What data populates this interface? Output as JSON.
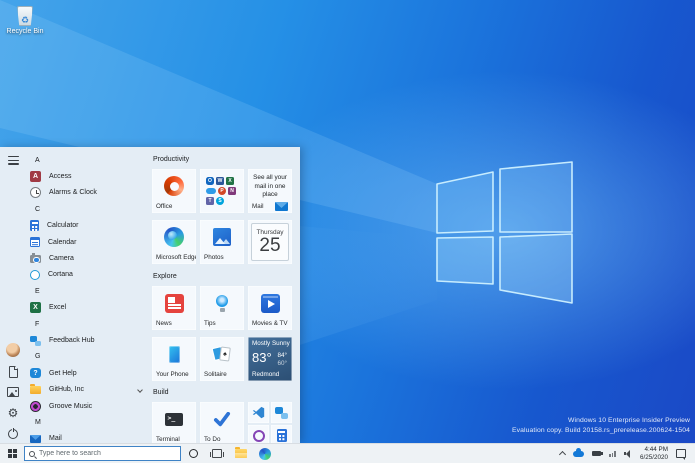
{
  "desktop": {
    "recycle_bin_label": "Recycle Bin",
    "watermark": {
      "line1": "Windows 10 Enterprise Insider Preview",
      "line2": "Evaluation copy. Build 20158.rs_prerelease.200624-1504"
    }
  },
  "start_menu": {
    "app_list": [
      {
        "type": "header",
        "label": "A"
      },
      {
        "type": "app",
        "label": "Access",
        "icon": "access-icon"
      },
      {
        "type": "app",
        "label": "Alarms & Clock",
        "icon": "alarms-clock-icon"
      },
      {
        "type": "header",
        "label": "C"
      },
      {
        "type": "app",
        "label": "Calculator",
        "icon": "calculator-icon"
      },
      {
        "type": "app",
        "label": "Calendar",
        "icon": "calendar-icon"
      },
      {
        "type": "app",
        "label": "Camera",
        "icon": "camera-icon"
      },
      {
        "type": "app",
        "label": "Cortana",
        "icon": "cortana-icon"
      },
      {
        "type": "header",
        "label": "E"
      },
      {
        "type": "app",
        "label": "Excel",
        "icon": "excel-icon"
      },
      {
        "type": "header",
        "label": "F"
      },
      {
        "type": "app",
        "label": "Feedback Hub",
        "icon": "feedback-hub-icon"
      },
      {
        "type": "header",
        "label": "G"
      },
      {
        "type": "app",
        "label": "Get Help",
        "icon": "get-help-icon"
      },
      {
        "type": "app",
        "label": "GitHub, Inc",
        "icon": "folder-icon"
      },
      {
        "type": "app",
        "label": "Groove Music",
        "icon": "groove-music-icon"
      },
      {
        "type": "header",
        "label": "M"
      },
      {
        "type": "app",
        "label": "Mail",
        "icon": "mail-icon"
      }
    ],
    "groups": [
      {
        "title": "Productivity",
        "tiles": {
          "office": {
            "label": "Office"
          },
          "mail": {
            "label": "Mail",
            "live_text": "See all your mail in one place"
          },
          "edge": {
            "label": "Microsoft Edge"
          },
          "photos": {
            "label": "Photos"
          },
          "calendar": {
            "weekday": "Thursday",
            "day": "25"
          }
        }
      },
      {
        "title": "Explore",
        "tiles": {
          "news": {
            "label": "News"
          },
          "tips": {
            "label": "Tips"
          },
          "movies": {
            "label": "Movies & TV"
          },
          "your_phone": {
            "label": "Your Phone"
          },
          "solitaire": {
            "label": "Solitaire"
          },
          "weather": {
            "condition": "Mostly Sunny",
            "temp": "83°",
            "high": "84°",
            "low": "60°",
            "location": "Redmond"
          }
        }
      },
      {
        "title": "Build",
        "tiles": {
          "terminal": {
            "label": "Terminal"
          },
          "todo": {
            "label": "To Do"
          }
        }
      }
    ]
  },
  "taskbar": {
    "search": {
      "placeholder": "Type here to search"
    },
    "clock": {
      "time": "4:44 PM",
      "date": "6/25/2020"
    }
  }
}
